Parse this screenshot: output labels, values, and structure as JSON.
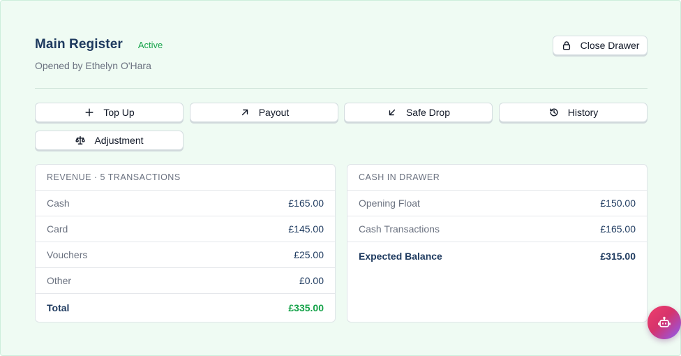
{
  "register": {
    "title": "Main Register",
    "status": "Active",
    "opened_by": "Opened by Ethelyn O'Hara",
    "close_label": "Close Drawer"
  },
  "actions": [
    {
      "label": "Top Up",
      "icon": "plus-icon"
    },
    {
      "label": "Payout",
      "icon": "arrow-up-right-icon"
    },
    {
      "label": "Safe Drop",
      "icon": "arrow-down-left-icon"
    },
    {
      "label": "History",
      "icon": "history-icon"
    },
    {
      "label": "Adjustment",
      "icon": "scale-icon"
    }
  ],
  "revenue": {
    "heading": "REVENUE · 5 TRANSACTIONS",
    "rows": [
      {
        "label": "Cash",
        "value": "£165.00"
      },
      {
        "label": "Card",
        "value": "£145.00"
      },
      {
        "label": "Vouchers",
        "value": "£25.00"
      },
      {
        "label": "Other",
        "value": "£0.00"
      }
    ],
    "total_label": "Total",
    "total_value": "£335.00"
  },
  "cash": {
    "heading": "CASH IN DRAWER",
    "rows": [
      {
        "label": "Opening Float",
        "value": "£150.00"
      },
      {
        "label": "Cash Transactions",
        "value": "£165.00"
      }
    ],
    "expected_label": "Expected Balance",
    "expected_value": "£315.00"
  },
  "colors": {
    "accent_green": "#16a34a",
    "title_navy": "#1e3a5f",
    "background": "#effbf3"
  },
  "assistant": {
    "icon": "robot-icon"
  }
}
